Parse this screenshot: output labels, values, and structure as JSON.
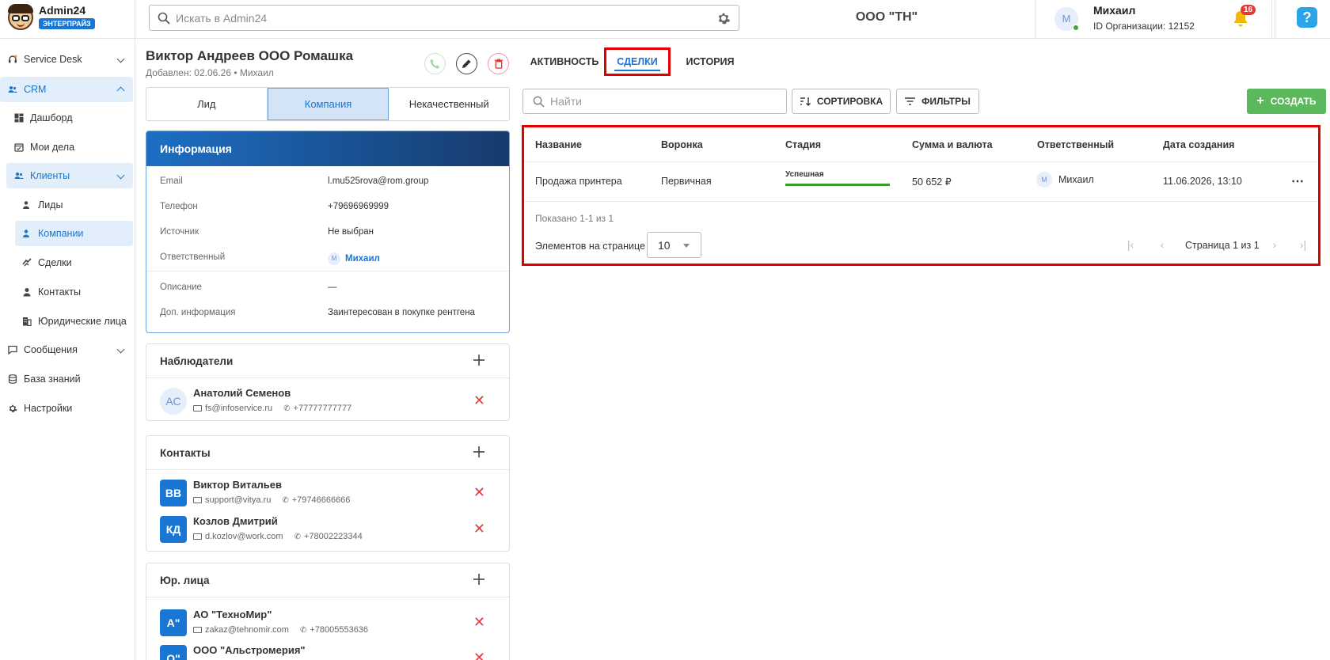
{
  "app": {
    "name": "Admin24",
    "badge": "ЭНТЕРПРАЙЗ"
  },
  "header": {
    "search_placeholder": "Искать в Admin24",
    "org_title": "ООО \"ТН\"",
    "user": {
      "initial": "М",
      "name": "Михаил",
      "org_id": "ID Организации: 12152"
    },
    "notifications_count": "16",
    "help": "?"
  },
  "sidebar": {
    "items": [
      {
        "label": "Service Desk"
      },
      {
        "label": "CRM"
      },
      {
        "label": "Дашборд"
      },
      {
        "label": "Мои дела"
      },
      {
        "label": "Клиенты"
      },
      {
        "label": "Лиды"
      },
      {
        "label": "Компании"
      },
      {
        "label": "Сделки"
      },
      {
        "label": "Контакты"
      },
      {
        "label": "Юридические лица"
      },
      {
        "label": "Сообщения"
      },
      {
        "label": "База знаний"
      },
      {
        "label": "Настройки"
      }
    ]
  },
  "entity": {
    "title": "Виктор Андреев ООО Ромашка",
    "subtitle": "Добавлен: 02.06.26 • Михаил"
  },
  "type_tabs": [
    "Лид",
    "Компания",
    "Некачественный"
  ],
  "info": {
    "title": "Информация",
    "rows": [
      {
        "label": "Email",
        "value": "l.mu525rova@rom.group"
      },
      {
        "label": "Телефон",
        "value": "+79696969999"
      },
      {
        "label": "Источник",
        "value": "Не выбран"
      },
      {
        "label": "Ответственный",
        "value": "Михаил",
        "initial": "М"
      },
      {
        "label": "Описание",
        "value": "—"
      },
      {
        "label": "Доп. информация",
        "value": "Заинтересован в покупке рентгена"
      }
    ]
  },
  "observers": {
    "title": "Наблюдатели",
    "items": [
      {
        "initials": "АС",
        "name": "Анатолий Семенов",
        "email": "fs@infoservice.ru",
        "phone": "+77777777777"
      }
    ]
  },
  "contacts": {
    "title": "Контакты",
    "items": [
      {
        "initials": "ВВ",
        "name": "Виктор Витальев",
        "email": "support@vitya.ru",
        "phone": "+79746666666"
      },
      {
        "initials": "КД",
        "name": "Козлов Дмитрий",
        "email": "d.kozlov@work.com",
        "phone": "+78002223344"
      }
    ]
  },
  "legal": {
    "title": "Юр. лица",
    "items": [
      {
        "initials": "А\"",
        "name": "АО \"ТехноМир\"",
        "email": "zakaz@tehnomir.com",
        "phone": "+78005553636"
      },
      {
        "initials": "О\"",
        "name": "ООО \"Альстромерия\""
      }
    ]
  },
  "right_tabs": [
    "АКТИВНОСТЬ",
    "СДЕЛКИ",
    "ИСТОРИЯ"
  ],
  "toolbar": {
    "find_placeholder": "Найти",
    "sort_label": "СОРТИРОВКА",
    "filter_label": "ФИЛЬТРЫ",
    "create_label": "СОЗДАТЬ"
  },
  "deals_table": {
    "columns": [
      "Название",
      "Воронка",
      "Стадия",
      "Сумма и валюта",
      "Ответственный",
      "Дата создания"
    ],
    "rows": [
      {
        "name": "Продажа принтера",
        "funnel": "Первичная",
        "stage": "Успешная",
        "amount": "50 652 ₽",
        "owner_initial": "М",
        "owner": "Михаил",
        "created": "11.06.2026, 13:10"
      }
    ],
    "shown": "Показано 1-1 из 1",
    "per_page_label": "Элементов на странице",
    "per_page_value": "10",
    "page_info": "Страница 1 из 1"
  },
  "colors": {
    "accent": "#1976d2",
    "create": "#5cb85c",
    "highlight": "#e00000",
    "stage_success": "#3a9a2a"
  }
}
